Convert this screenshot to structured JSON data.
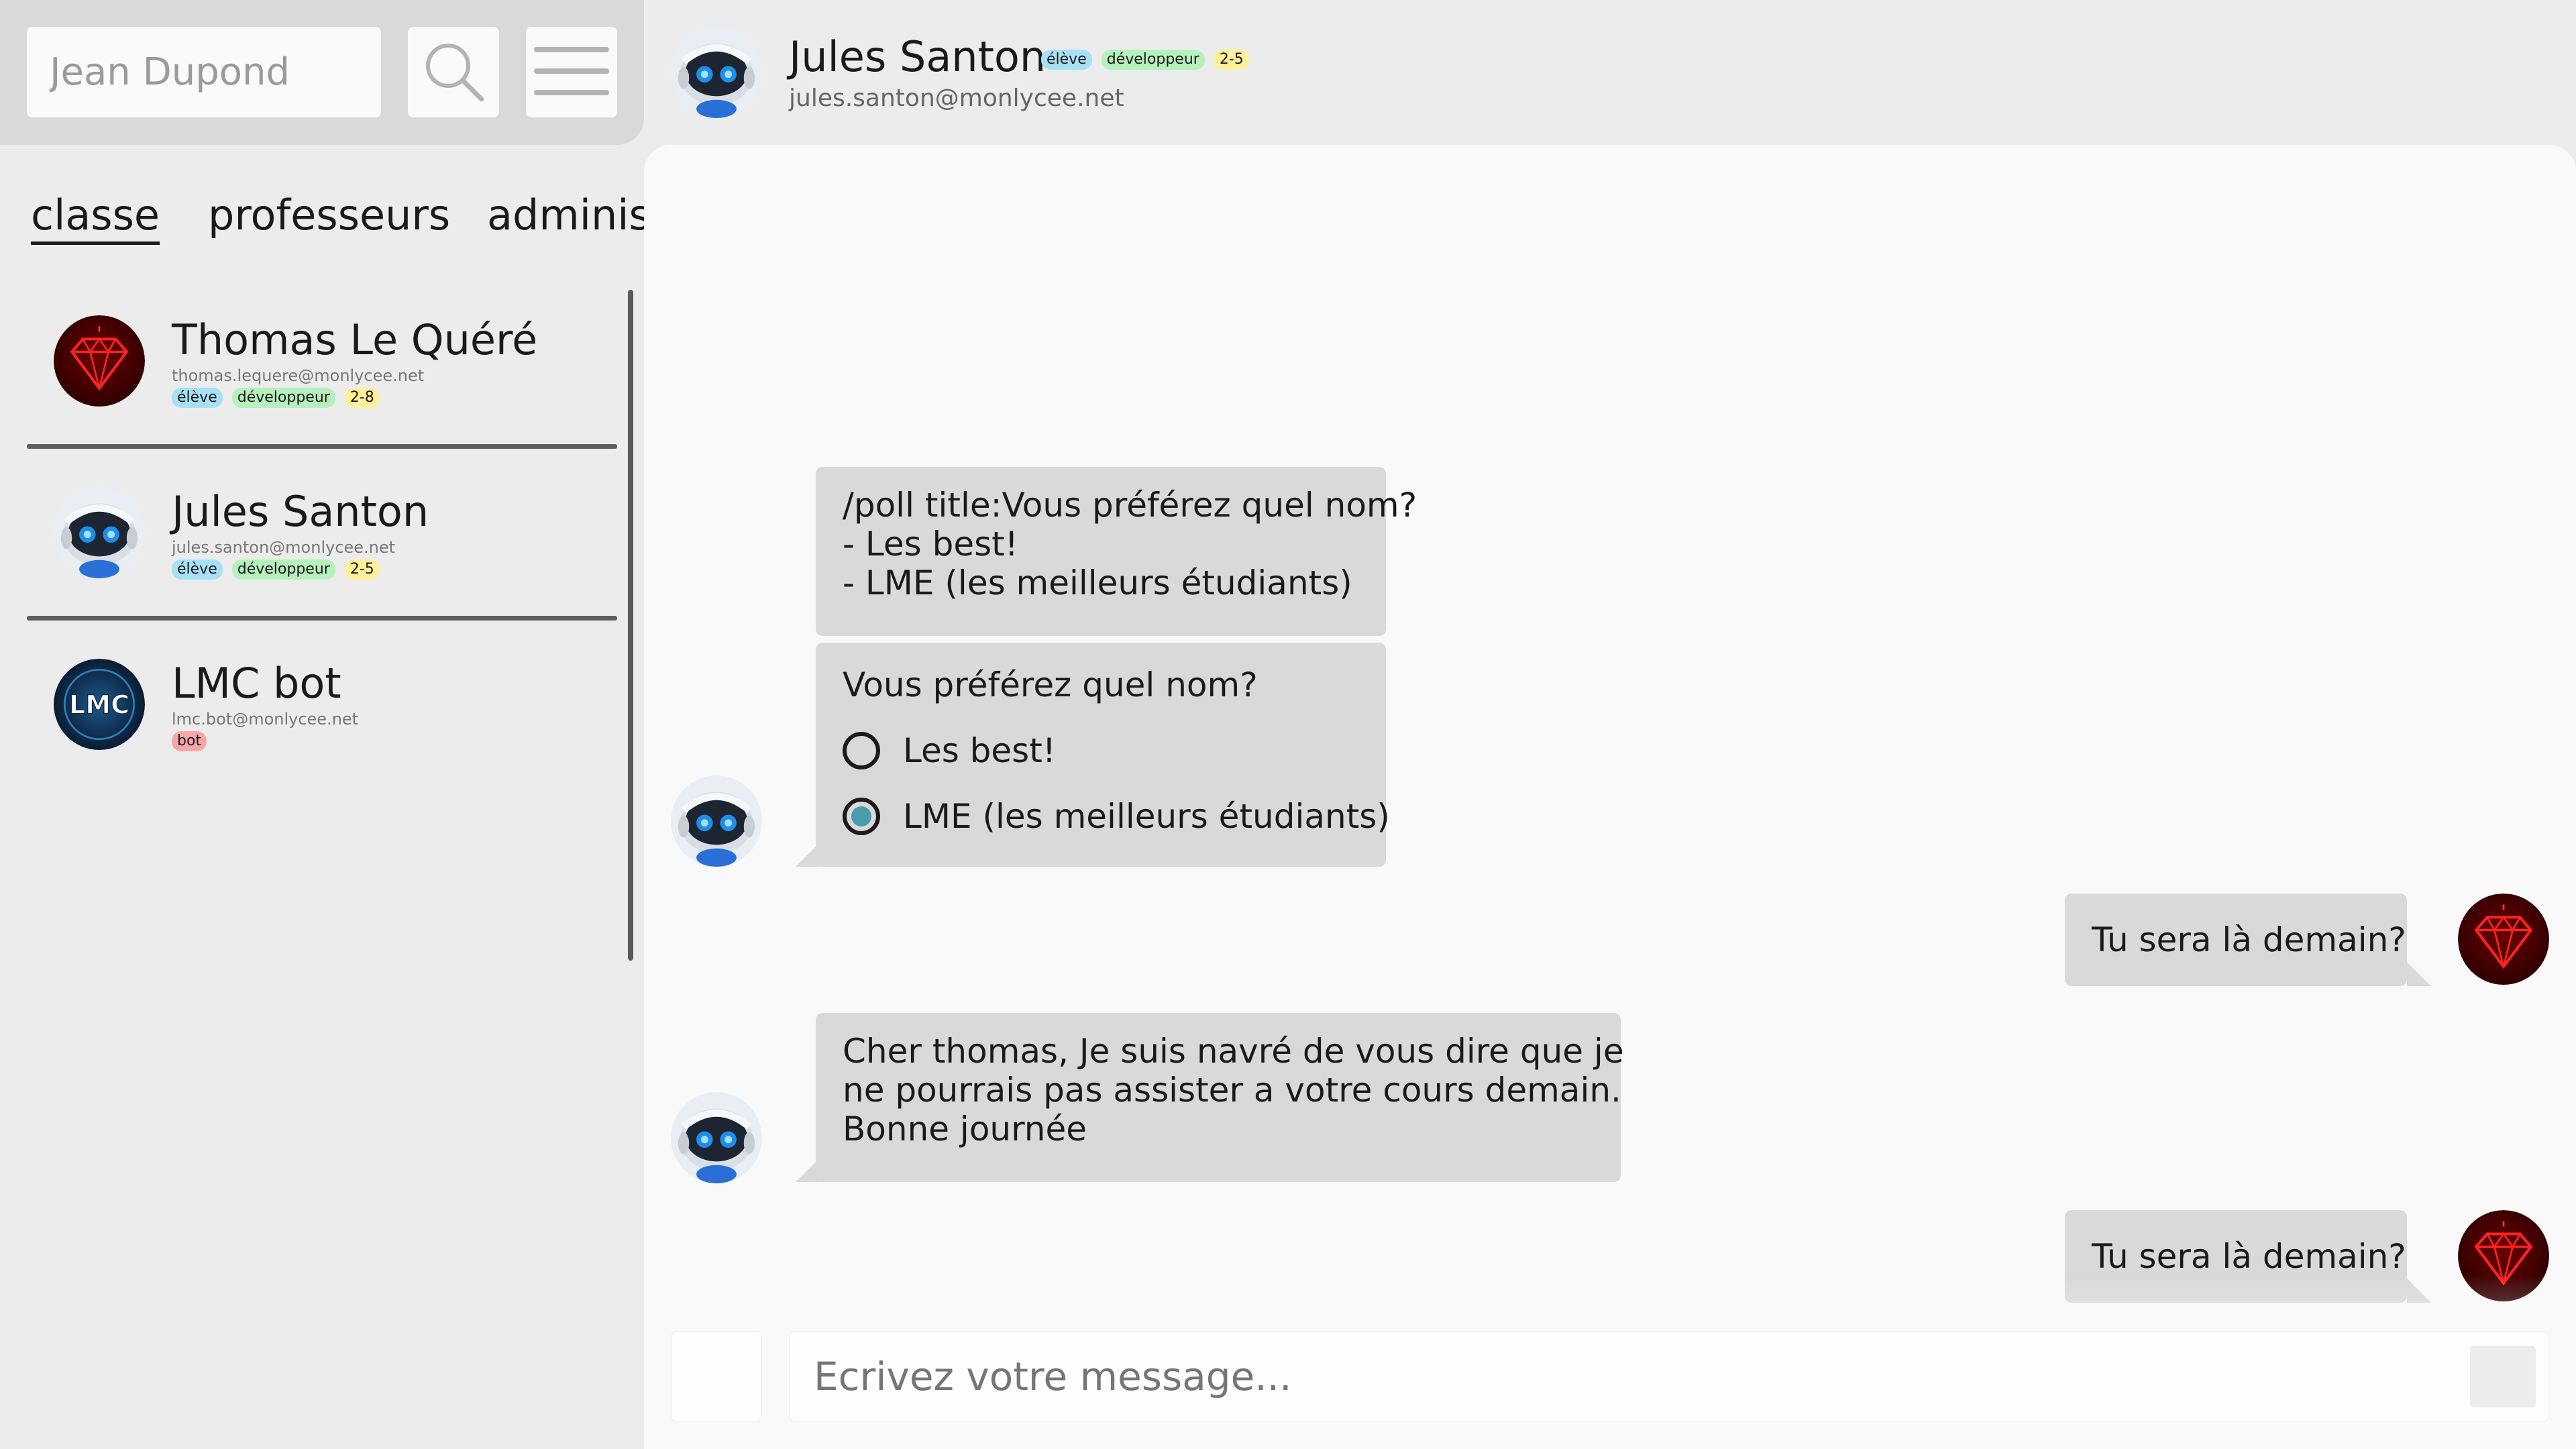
{
  "sidebar": {
    "user_input_value": "Jean Dupond",
    "tabs": [
      {
        "label": "classe",
        "active": true
      },
      {
        "label": "professeurs",
        "active": false
      },
      {
        "label": "administration",
        "active": false
      }
    ],
    "contacts": [
      {
        "name": "Thomas Le Quéré",
        "email": "thomas.lequere@monlycee.net",
        "badges": [
          "élève",
          "développeur",
          "2-8"
        ],
        "avatar": "ruby-gem-icon"
      },
      {
        "name": "Jules Santon",
        "email": "jules.santon@monlycee.net",
        "badges": [
          "élève",
          "développeur",
          "2-5"
        ],
        "avatar": "robot-icon"
      },
      {
        "name": "LMC bot",
        "email": "lmc.bot@monlycee.net",
        "badges": [
          "bot"
        ],
        "avatar": "lmc-logo-icon"
      }
    ]
  },
  "header": {
    "name": "Jules Santon",
    "badges": [
      "élève",
      "développeur",
      "2-5"
    ],
    "email": "jules.santon@monlycee.net"
  },
  "chat": {
    "messages": [
      {
        "from": "Jules Santon",
        "lines": [
          "/poll title:Vous préférez quel nom?",
          "- Les best!",
          "- LME (les meilleurs étudiants)"
        ]
      },
      {
        "from": "Jules Santon",
        "poll": {
          "title": "Vous préférez quel nom?",
          "options": [
            {
              "label": "Les best!",
              "checked": false
            },
            {
              "label": "LME (les meilleurs étudiants)",
              "checked": true
            }
          ]
        }
      },
      {
        "from": "Thomas Le Quéré",
        "lines": [
          "Tu sera là demain?"
        ]
      },
      {
        "from": "Jules Santon",
        "lines": [
          "Cher thomas, Je suis navré de vous dire que je",
          "ne pourrais pas assister a votre cours demain.",
          "Bonne journée"
        ]
      },
      {
        "from": "Thomas Le Quéré",
        "lines": [
          "Tu sera là demain?"
        ]
      }
    ]
  },
  "composer": {
    "placeholder": "Ecrivez votre message..."
  },
  "colors": {
    "accent_radio": "#4a9aad",
    "badge_eleve": "#a7e1f5",
    "badge_dev": "#b5f0bd",
    "badge_group": "#fff19a",
    "badge_bot": "#f7a7a7"
  }
}
